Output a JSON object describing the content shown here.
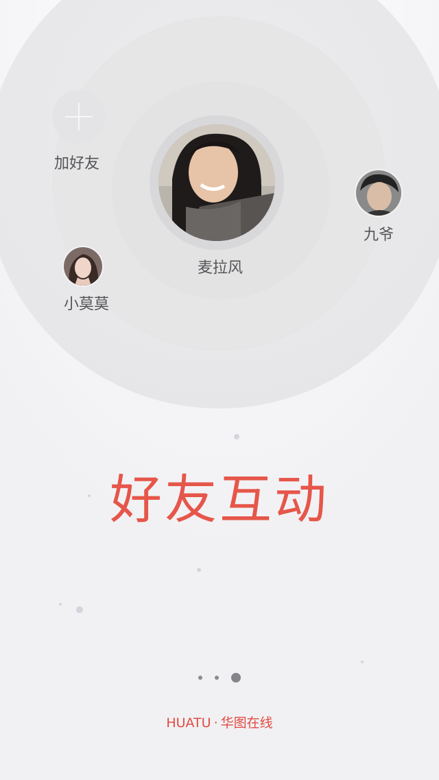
{
  "friends": {
    "add": {
      "label": "加好友"
    },
    "main": {
      "name": "麦拉风"
    },
    "right": {
      "name": "九爷"
    },
    "left": {
      "name": "小莫莫"
    }
  },
  "headline": "好友互动",
  "pager": {
    "count": 3,
    "active_index": 2
  },
  "footer": {
    "brand_en": "HUATU",
    "separator": "·",
    "brand_cn": "华图在线"
  },
  "colors": {
    "accent": "#e6564a",
    "background": "#f1f1f4"
  }
}
